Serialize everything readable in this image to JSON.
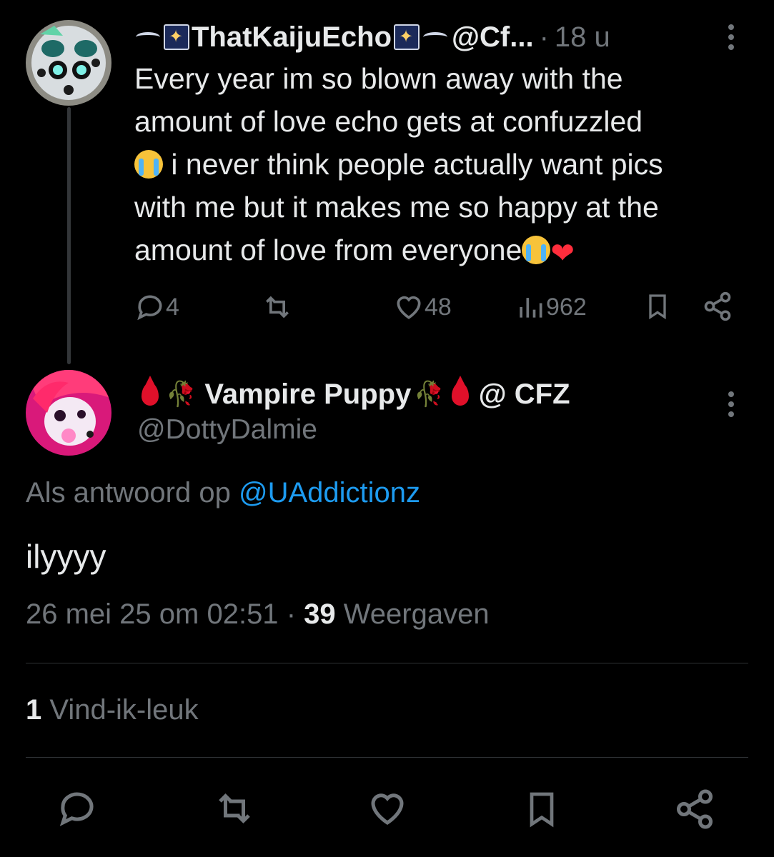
{
  "parent_tweet": {
    "display_name": "ThatKaijuEcho",
    "handle": "@Cf...",
    "separator": "·",
    "time": "18 u",
    "text_lines": [
      "Every year im so blown away with the",
      "amount of love echo gets at confuzzled",
      " i never think people actually want pics",
      "with me but it makes me so happy at the",
      "amount of love from everyone"
    ],
    "stats": {
      "replies": "4",
      "retweets": "",
      "likes": "48",
      "views": "962"
    },
    "avatar_icon": "kaiju-avatar-icon"
  },
  "reply_tweet": {
    "display_name": "Vampire Puppy",
    "display_suffix": "@ CFZ",
    "handle": "@DottyDalmie",
    "replying_to_label": "Als antwoord op",
    "replying_to_handle": "@UAddictionz",
    "text": "ilyyyy",
    "date": "26 mei 25 om 02:51",
    "separator": "·",
    "view_count": "39",
    "view_label": "Weergaven",
    "like_count": "1",
    "like_label": "Vind-ik-leuk",
    "avatar_icon": "vampire-puppy-avatar-icon"
  },
  "colors": {
    "background": "#000000",
    "text_primary": "#e7e9ea",
    "text_secondary": "#71767b",
    "link": "#1d9bf0",
    "divider": "#2f3336"
  },
  "icons": {
    "reply": "reply-icon",
    "retweet": "retweet-icon",
    "like": "heart-icon",
    "views": "views-icon",
    "bookmark": "bookmark-icon",
    "share": "share-icon",
    "more": "more-icon"
  }
}
